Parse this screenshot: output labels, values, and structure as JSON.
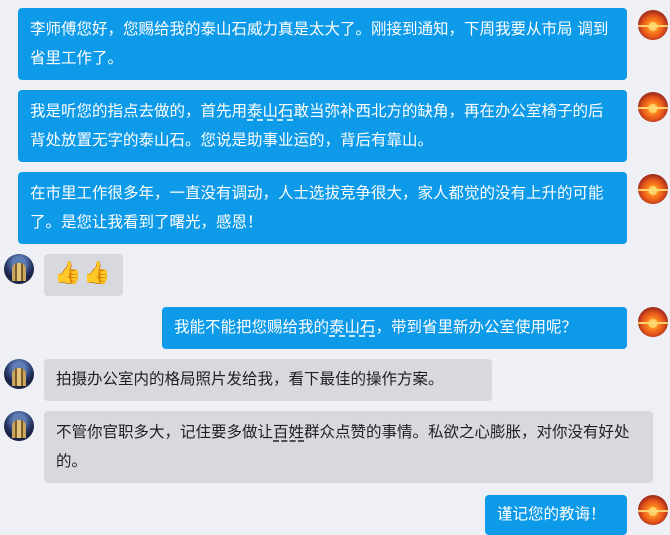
{
  "messages": [
    {
      "direction": "outgoing",
      "text": "李师傅您好，您赐给我的泰山石威力真是太大了。刚接到通知，下周我要从市局 调到省里工作了。"
    },
    {
      "direction": "outgoing",
      "text_a": "我是听您的指点去做的，首先用",
      "text_u": "泰山石",
      "text_b": "敢当弥补西北方的缺角，再在办公室椅子的后背处放置无字的泰山石。您说是助事业运的，背后有靠山。"
    },
    {
      "direction": "outgoing",
      "text": "在市里工作很多年，一直没有调动，人士选拔竞争很大，家人都觉的没有上升的可能了。是您让我看到了曙光，感恩！"
    },
    {
      "direction": "incoming",
      "text": "👍👍"
    },
    {
      "direction": "outgoing",
      "text_a": "我能不能把您赐给我的",
      "text_u": "泰山石",
      "text_b": "，带到省里新办公室使用呢？"
    },
    {
      "direction": "incoming",
      "text": "拍摄办公室内的格局照片发给我，看下最佳的操作方案。"
    },
    {
      "direction": "incoming",
      "text_a": "不管你官职多大，记住要多做让",
      "text_u": "百姓",
      "text_b": "群众点赞的事情。私欲之心膨胀，对你没有好处的。"
    },
    {
      "direction": "outgoing",
      "text": "谨记您的教诲！"
    }
  ],
  "colors": {
    "outgoing_bubble": "#0d9ae8",
    "incoming_bubble": "#d7d9df",
    "background": "#eef0f6"
  },
  "avatars": {
    "self": "sunset-avatar",
    "other": "building-avatar"
  }
}
